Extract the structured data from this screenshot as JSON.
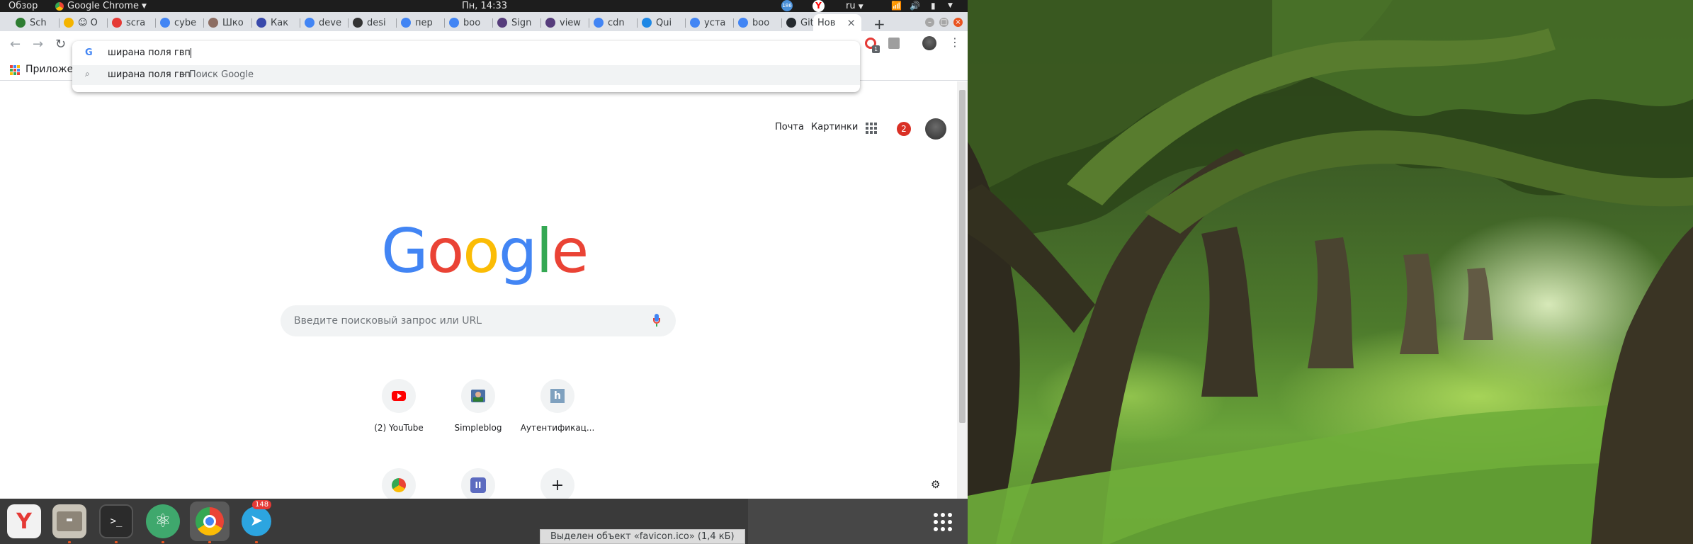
{
  "topbar": {
    "activities": "Обзор",
    "app_menu": "Google Chrome",
    "clock": "Пн, 14:33",
    "language": "ru",
    "notif_badge": "186"
  },
  "tabs": [
    {
      "label": "Sch",
      "color": "#2e7d32"
    },
    {
      "label": "☺ O",
      "color": "#f4b400"
    },
    {
      "label": "scra",
      "color": "#e53935"
    },
    {
      "label": "cybe",
      "color": "#4285f4"
    },
    {
      "label": "Шко",
      "color": "#8d6e63"
    },
    {
      "label": "Как",
      "color": "#3949ab"
    },
    {
      "label": "deve",
      "color": "#4285f4"
    },
    {
      "label": "desi",
      "color": "#333333"
    },
    {
      "label": "пер",
      "color": "#4285f4"
    },
    {
      "label": "boo",
      "color": "#4285f4"
    },
    {
      "label": "Sign",
      "color": "#563d7c"
    },
    {
      "label": "view",
      "color": "#563d7c"
    },
    {
      "label": "cdn",
      "color": "#4285f4"
    },
    {
      "label": "Qui",
      "color": "#1e88e5"
    },
    {
      "label": "уста",
      "color": "#4285f4"
    },
    {
      "label": "boo",
      "color": "#4285f4"
    },
    {
      "label": "Gith",
      "color": "#24292e"
    },
    {
      "label": "Нов",
      "color": "#ffffff"
    }
  ],
  "bookmarks": {
    "apps_label": "Приложе"
  },
  "omnibox": {
    "value": "ширана поля гвп",
    "suggestion_query": "ширана поля гвп",
    "suggestion_suffix": " - Поиск Google"
  },
  "profile_badge": "1",
  "newtab": {
    "links": {
      "mail": "Почта",
      "images": "Картинки"
    },
    "notif_count": "2",
    "search_placeholder": "Введите поисковый запрос или URL",
    "shortcuts": [
      {
        "label": "(2) YouTube",
        "icon": "youtube-icon"
      },
      {
        "label": "Simpleblog",
        "icon": "simpleblog-icon"
      },
      {
        "label": "Аутентификац...",
        "icon": "hexlet-icon"
      }
    ],
    "shortcuts_row2": [
      "chrome-web-store-icon",
      "pause-app-icon",
      "add-shortcut-icon"
    ]
  },
  "dock": {
    "telegram_badge": "148",
    "status_text": "Выделен объект «favicon.ico» (1,4 кБ)"
  },
  "colors": {
    "accent": "#e95420",
    "google_blue": "#4285f4",
    "google_red": "#ea4335",
    "google_yellow": "#fbbc05",
    "google_green": "#34a853"
  }
}
